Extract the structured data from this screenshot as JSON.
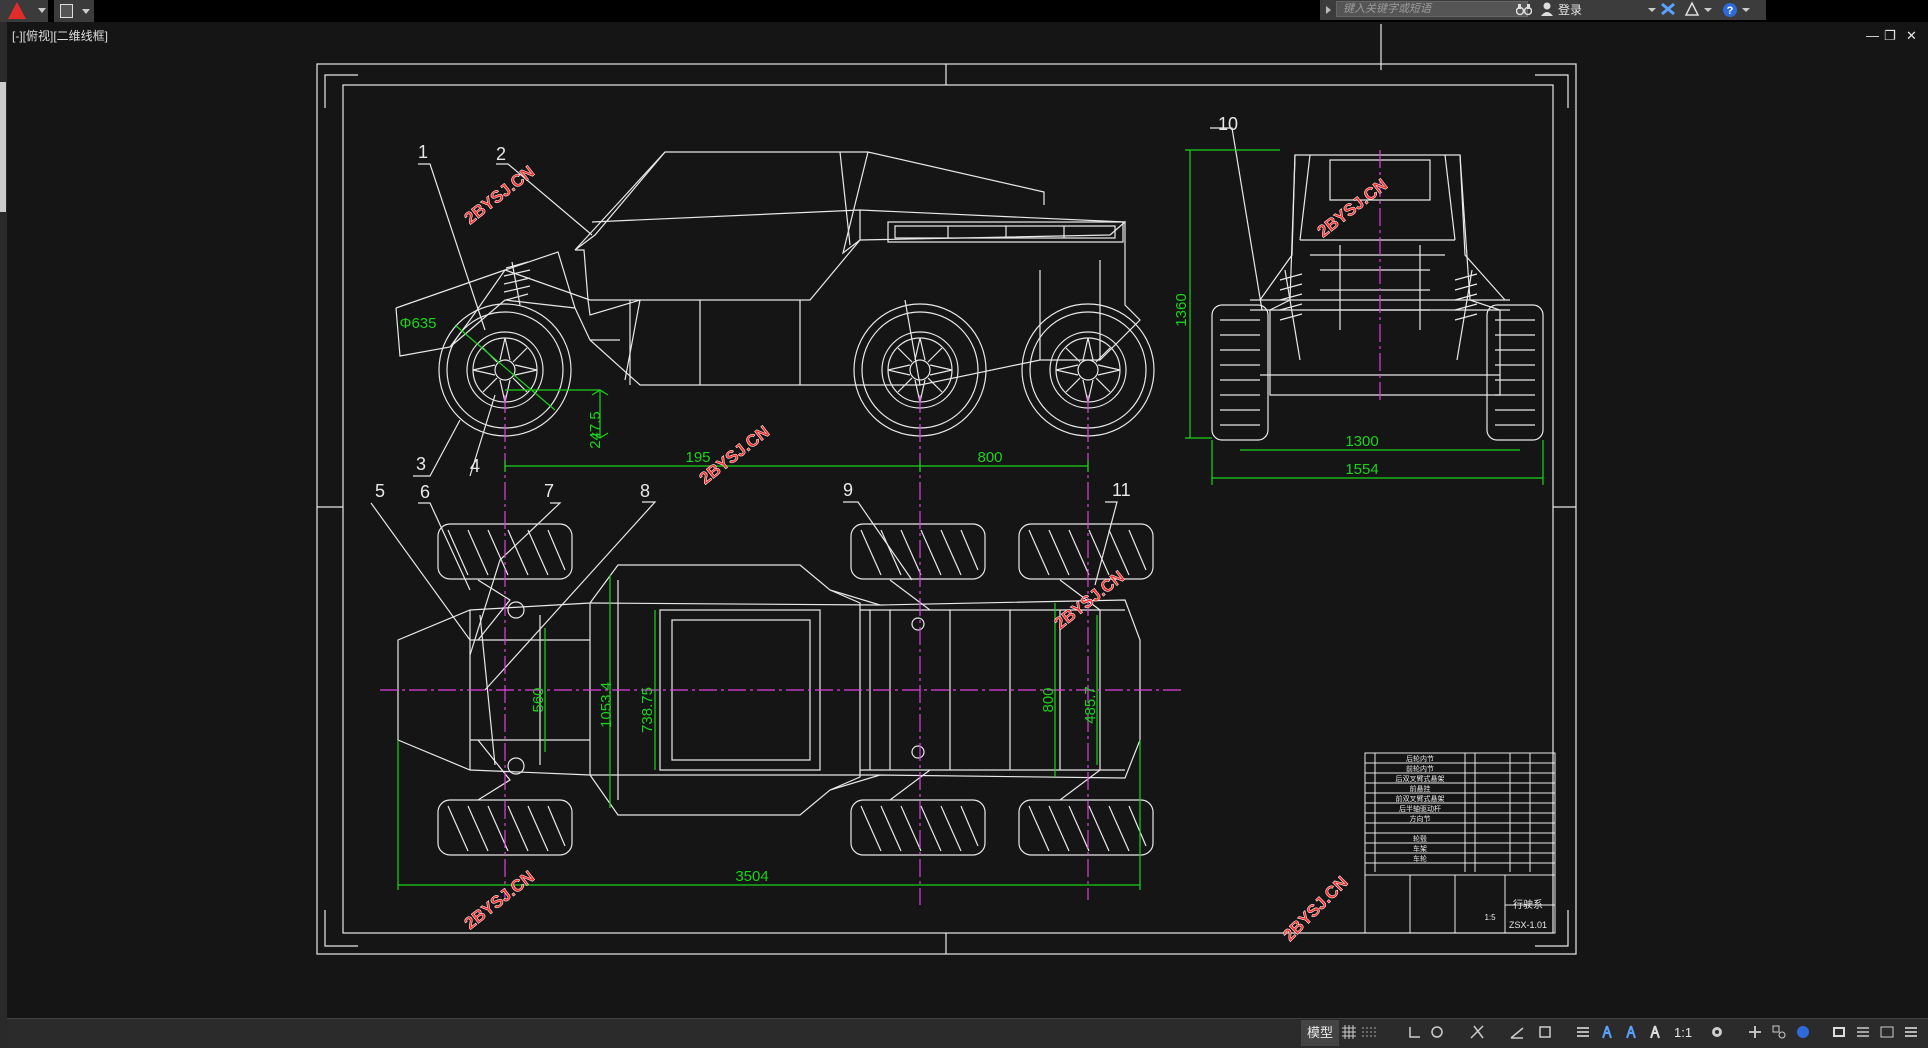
{
  "toolbar": {
    "search_placeholder": "键入关键字或短语",
    "login_label": "登录"
  },
  "viewport": {
    "label": "[-][俯视][二维线框]"
  },
  "drawing": {
    "callouts": [
      "1",
      "2",
      "3",
      "4",
      "5",
      "6",
      "7",
      "8",
      "9",
      "10",
      "11"
    ],
    "dimensions": {
      "wheel_diameter": "Φ635",
      "ground_clearance": "247.5",
      "wheelbase_front": "195",
      "wheelbase_rear": "800",
      "height": "1360",
      "track_inner": "1300",
      "track_outer": "1554",
      "total_length": "3504",
      "front_width": "560",
      "frame_width_a": "1053.4",
      "frame_width_b": "738.75",
      "rear_width": "800",
      "rear_inner": "485.7"
    },
    "watermark": "2BYSJ.CN",
    "title_block": {
      "drawing_name": "行驶系",
      "drawing_number": "ZSX-1.01",
      "scale": "1:5"
    },
    "parts_list": [
      "后轮内节",
      "前轮内节",
      "后双叉臂式悬架",
      "前悬挂",
      "前双叉臂式悬架",
      "后半轴驱动杆",
      "方向节",
      "",
      "轮毂",
      "车架",
      "车轮"
    ]
  },
  "statusbar": {
    "model_tab": "模型",
    "scale": "1:1"
  },
  "colors": {
    "background": "#151515",
    "line": "#ffffff",
    "dimension": "#18d418",
    "centerline": "#e040e0",
    "watermark": "#e02020"
  }
}
